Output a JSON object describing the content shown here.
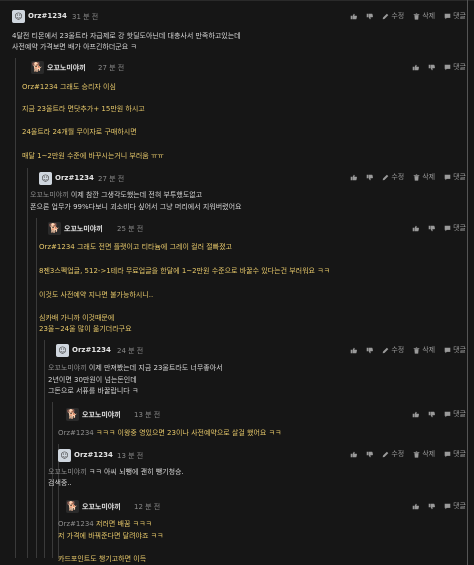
{
  "comments": [
    {
      "user": "Orz#1234",
      "time": "31 분 전",
      "lines": [
        "4달전 티몬에서 23울트라 자급제로 강 핫딜도아닌데 대충사서 만족하고있는데",
        "사전예약 가격보면 배가 아프긴하더군요 ㅋ"
      ]
    },
    {
      "user": "오꼬노미야끼",
      "time": "27 분 전",
      "lines": [
        "Orz#1234 그래도 승리자 이심",
        "지금 23울트라 면닷추가+ 15만원 하시고",
        "24울트라 24개월 무이자로 구매하시면",
        "매달 1~2만원 수준에 바꾸시는거니 부러움 ㅠㅠ"
      ]
    },
    {
      "user": "Orz#1234",
      "time": "27 분 전",
      "mention": "오꼬노미야끼",
      "lines": [
        "이제 참깐 그생각도했는데 전혀 부투했도없고",
        "폰으론 업무가 99%다보니 괴소비다 싶어서 그냥 머리에서 지워버렸어요"
      ]
    },
    {
      "user": "오꼬노미야끼",
      "time": "25 분 전",
      "lines": [
        "Orz#1234 그래도 전면 플랫이고 티타늄에 그레이 컬러 절빠졌고",
        "8젠3스펙업글, 512->1테라 무료업글을 한달에 1~2만원 수준으로 바꿀수 있다는건 부러워요 ㅋㅋ",
        "이것도 사전예약 지나면 불가능하시니..",
        "심카배 가니까 이것때문에",
        "23울~24울 많이 옮기더라구요"
      ]
    },
    {
      "user": "Orz#1234",
      "time": "24 분 전",
      "mention": "오꼬노미야끼",
      "lines": [
        "이제 만져봤는데 지금 23울트라도 너무좋아서",
        "2년이면 30만원이 넘는돈인데",
        "그돈으로 서퓨를 바꿀랍니다 ㅋ"
      ]
    },
    {
      "user": "오꼬노미야끼",
      "time": "13 분 전",
      "mention": "Orz#1234",
      "lines": [
        "ㅋㅋㅋ 이왕중 영있으면 23이나 사전예약으로 살걸 했어요 ㅋㅋ"
      ]
    },
    {
      "user": "Orz#1234",
      "time": "13 분 전",
      "mention": "오꼬노미야끼",
      "lines": [
        "ㅋㅋ 아씨 뇌뺑에 괜히 뺑기청승.",
        "검색중.."
      ]
    },
    {
      "user": "오꼬노미야끼",
      "time": "12 분 전",
      "mention": "Orz#1234",
      "lines": [
        "저러면 배꿈 ㅋㅋㅋ",
        "저 가격에 바꿔준다면 달려야죠 ㅋㅋ",
        "카드포인트도 챙기고하면 이득"
      ]
    }
  ],
  "actions": {
    "edit": "수정",
    "delete": "삭제",
    "reply": "댓글"
  }
}
